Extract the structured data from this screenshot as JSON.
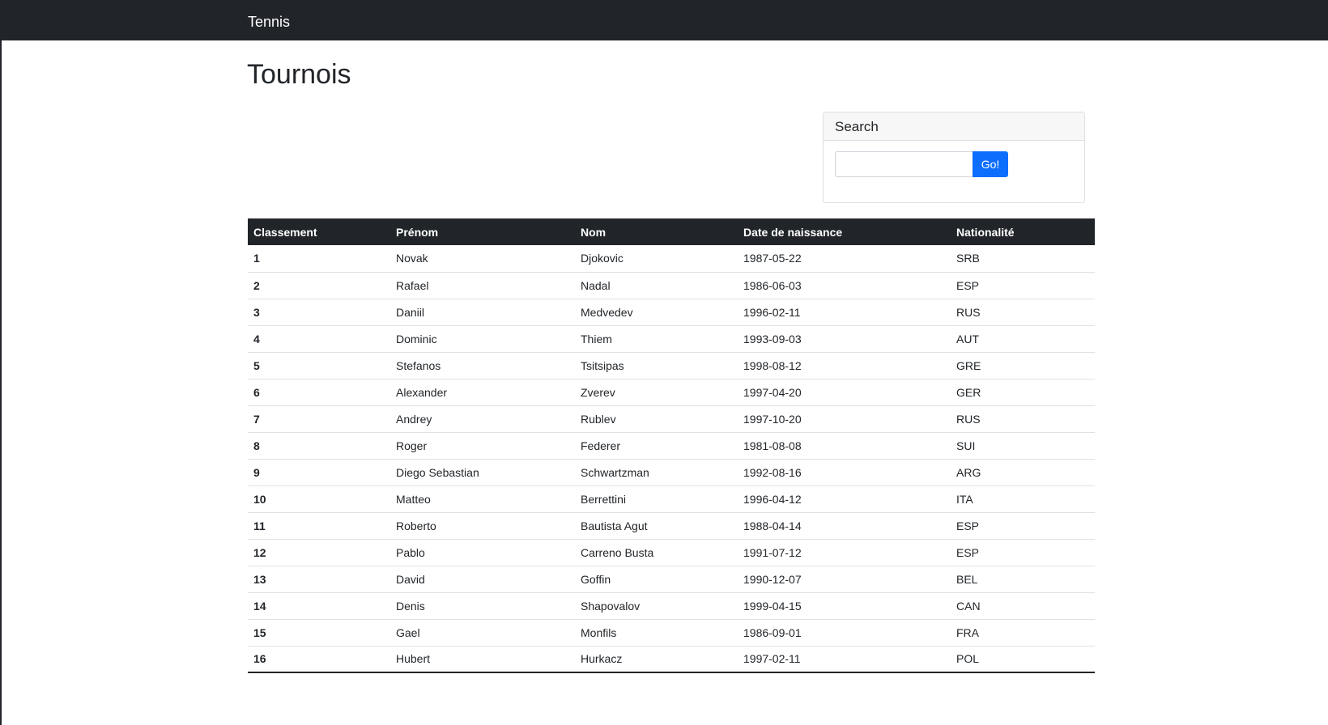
{
  "navbar": {
    "brand": "Tennis"
  },
  "page": {
    "title": "Tournois"
  },
  "search": {
    "header": "Search",
    "input_value": "",
    "button_label": "Go!"
  },
  "table": {
    "headers": [
      "Classement",
      "Prénom",
      "Nom",
      "Date de naissance",
      "Nationalité"
    ],
    "rows": [
      [
        "1",
        "Novak",
        "Djokovic",
        "1987-05-22",
        "SRB"
      ],
      [
        "2",
        "Rafael",
        "Nadal",
        "1986-06-03",
        "ESP"
      ],
      [
        "3",
        "Daniil",
        "Medvedev",
        "1996-02-11",
        "RUS"
      ],
      [
        "4",
        "Dominic",
        "Thiem",
        "1993-09-03",
        "AUT"
      ],
      [
        "5",
        "Stefanos",
        "Tsitsipas",
        "1998-08-12",
        "GRE"
      ],
      [
        "6",
        "Alexander",
        "Zverev",
        "1997-04-20",
        "GER"
      ],
      [
        "7",
        "Andrey",
        "Rublev",
        "1997-10-20",
        "RUS"
      ],
      [
        "8",
        "Roger",
        "Federer",
        "1981-08-08",
        "SUI"
      ],
      [
        "9",
        "Diego Sebastian",
        "Schwartzman",
        "1992-08-16",
        "ARG"
      ],
      [
        "10",
        "Matteo",
        "Berrettini",
        "1996-04-12",
        "ITA"
      ],
      [
        "11",
        "Roberto",
        "Bautista Agut",
        "1988-04-14",
        "ESP"
      ],
      [
        "12",
        "Pablo",
        "Carreno Busta",
        "1991-07-12",
        "ESP"
      ],
      [
        "13",
        "David",
        "Goffin",
        "1990-12-07",
        "BEL"
      ],
      [
        "14",
        "Denis",
        "Shapovalov",
        "1999-04-15",
        "CAN"
      ],
      [
        "15",
        "Gael",
        "Monfils",
        "1986-09-01",
        "FRA"
      ],
      [
        "16",
        "Hubert",
        "Hurkacz",
        "1997-02-11",
        "POL"
      ]
    ]
  },
  "colors": {
    "navbar_bg": "#212529",
    "primary": "#0d6efd",
    "table_header_bg": "#212529"
  }
}
